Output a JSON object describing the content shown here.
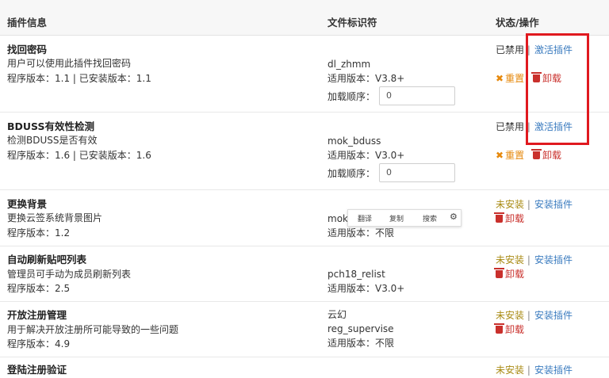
{
  "header": {
    "col_info": "插件信息",
    "col_file": "文件标识符",
    "col_status": "状态/操作"
  },
  "plugins": [
    {
      "name": "找回密码",
      "desc": "用户可以使用此插件找回密码",
      "version": "程序版本：1.1 | 已安装版本：1.1",
      "file_id": "dl_zhmm",
      "compat": "适用版本：V3.8+",
      "load_label": "加载顺序：",
      "load_value": "0",
      "status": "已禁用",
      "action": "激活插件",
      "reset": "重置",
      "uninstall": "卸载"
    },
    {
      "name": "BDUSS有效性检测",
      "desc": "检测BDUSS是否有效",
      "version": "程序版本：1.6 | 已安装版本：1.6",
      "file_id": "mok_bduss",
      "compat": "适用版本：V3.0+",
      "load_label": "加载顺序：",
      "load_value": "0",
      "status": "已禁用",
      "action": "激活插件",
      "reset": "重置",
      "uninstall": "卸载"
    },
    {
      "name": "更换背景",
      "desc": "更换云签系统背景图片",
      "version": "程序版本：1.2",
      "file_id": "mok_",
      "compat": "适用版本：不限",
      "status": "未安装",
      "action": "安装插件",
      "uninstall": "卸载"
    },
    {
      "name": "自动刷新贴吧列表",
      "desc": "管理员可手动为成员刷新列表",
      "version": "程序版本：2.5",
      "file_id": "pch18_relist",
      "compat": "适用版本：V3.0+",
      "status": "未安装",
      "action": "安装插件",
      "uninstall": "卸载"
    },
    {
      "name": "开放注册管理",
      "desc": "用于解决开放注册所可能导致的一些问题",
      "version": "程序版本：4.9",
      "author": "云幻",
      "file_id": "reg_supervise",
      "compat": "适用版本：不限",
      "status": "未安装",
      "action": "安装插件",
      "uninstall": "卸载"
    },
    {
      "name": "登陆注册验证",
      "status": "未安装",
      "action": "安装插件"
    }
  ],
  "popup": {
    "translate": "翻译",
    "copy": "复制",
    "search": "搜索"
  },
  "colors": {
    "link": "#3a7bbf",
    "danger": "#c9302c",
    "warning": "#e6890d",
    "not_installed": "#a88a12",
    "highlight_box": "#e0191f"
  },
  "icons": {
    "reset": "x-icon",
    "uninstall": "trash-icon",
    "settings": "gear-icon"
  }
}
